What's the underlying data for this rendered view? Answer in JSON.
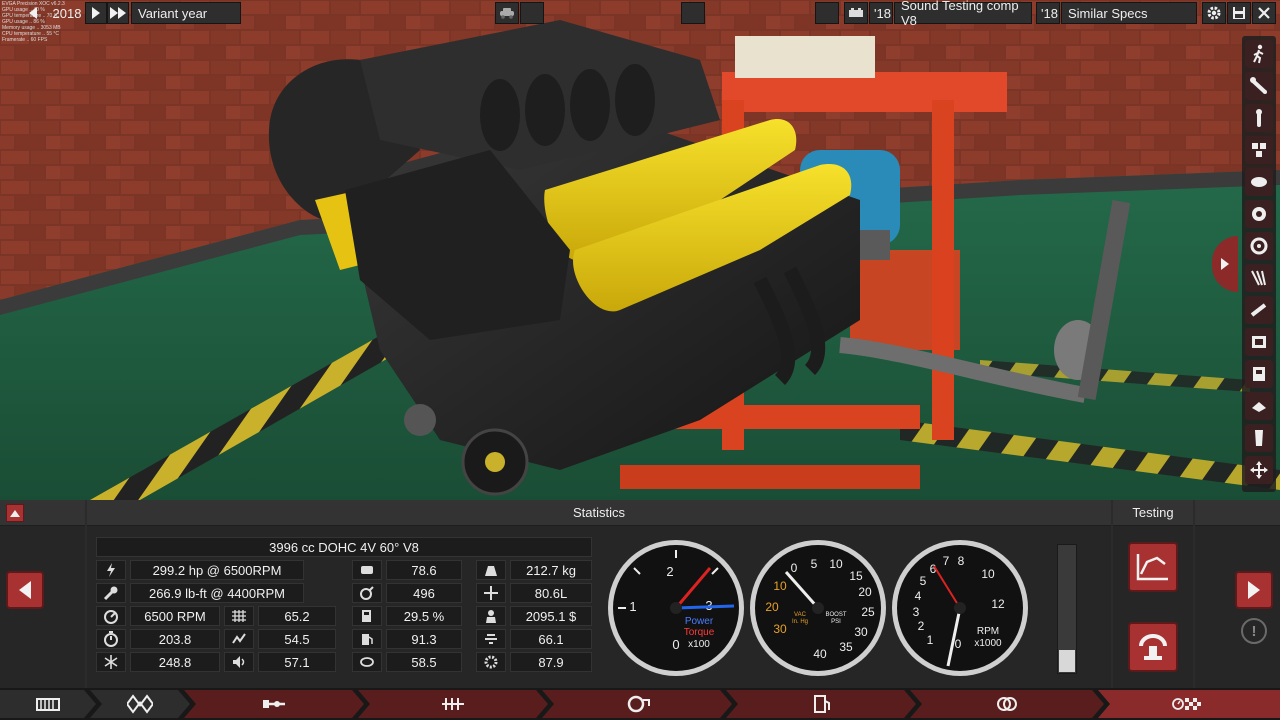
{
  "topbar": {
    "debug_text": "EVGA Precision XOC v6.2.3\nGPU usage .. 40 %\nGPU temperature .. 70 °C\nGPU usage .. 86 %\nMemory usage .. 3053 MB\nCPU temperature .. 55 °C\nFramerate .. 60 FPS",
    "variant_year_value": "2018",
    "variant_year_label": "Variant year",
    "family_year": "'18",
    "family_name": "Sound Testing comp V8",
    "variant_year_short": "'18",
    "variant_name": "Similar Specs"
  },
  "statistics": {
    "header": "Statistics",
    "engine_desc": "3996 cc DOHC 4V 60° V8",
    "col1": [
      {
        "icon": "power-icon",
        "value": "299.2 hp @ 6500RPM"
      },
      {
        "icon": "torque-wrench-icon",
        "value": "266.9 lb-ft @ 4400RPM"
      },
      {
        "icon": "rpm-gauge-icon",
        "value": "6500 RPM",
        "icon2": "radiator-icon",
        "value2": "65.2"
      },
      {
        "icon": "timer-icon",
        "value": "203.8",
        "icon2": "efficiency-icon",
        "value2": "54.5"
      },
      {
        "icon": "cooling-icon",
        "value": "248.8",
        "icon2": "speaker-icon",
        "value2": "57.1"
      }
    ],
    "col2": [
      {
        "icon": "smoothness-icon",
        "value": "78.6"
      },
      {
        "icon": "responsiveness-icon",
        "value": "496"
      },
      {
        "icon": "fuel-economy-icon",
        "value": "29.5 %"
      },
      {
        "icon": "fuel-pump-icon",
        "value": "91.3"
      },
      {
        "icon": "emissions-icon",
        "value": "58.5"
      }
    ],
    "col3": [
      {
        "icon": "weight-icon",
        "value": "212.7 kg"
      },
      {
        "icon": "size-icon",
        "value": "80.6L"
      },
      {
        "icon": "cost-icon",
        "value": "2095.1 $"
      },
      {
        "icon": "reliability-icon",
        "value": "66.1"
      },
      {
        "icon": "service-cost-icon",
        "value": "87.9"
      }
    ]
  },
  "gauges": {
    "power": {
      "ticks": [
        "0",
        "1",
        "2",
        "3"
      ],
      "label1": "Power",
      "label2": "Torque",
      "unit": "x100"
    },
    "boost": {
      "vac_ticks": [
        "10",
        "20",
        "30"
      ],
      "boost_ticks": [
        "0",
        "5",
        "10",
        "15",
        "20",
        "25",
        "30",
        "35",
        "40"
      ],
      "vac_label": "VAC",
      "vac_unit": "In. Hg",
      "boost_label": "BOOST",
      "boost_unit": "PSI"
    },
    "rpm": {
      "ticks": [
        "0",
        "1",
        "2",
        "3",
        "4",
        "5",
        "6",
        "7",
        "8",
        "10",
        "12"
      ],
      "label": "RPM",
      "unit": "x1000"
    }
  },
  "testing": {
    "header": "Testing"
  },
  "colors": {
    "accent_red": "#a83232",
    "panel": "#2b2b2b",
    "yellow_cover": "#f2d20e"
  }
}
